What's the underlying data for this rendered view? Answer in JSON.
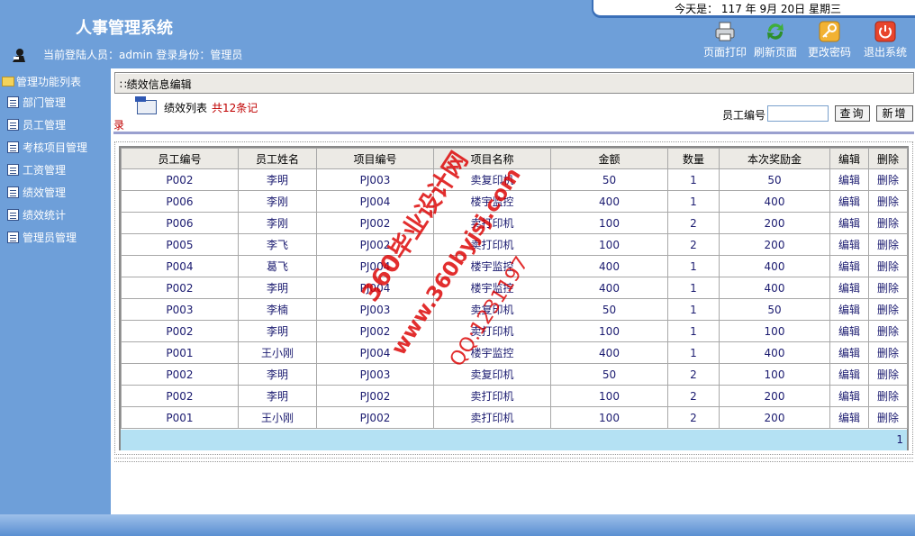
{
  "header": {
    "app_title": "人事管理系统",
    "date_text": "今天是： 117 年 9月 20日 星期三",
    "user_info": "当前登陆人员：admin 登录身份：管理员",
    "tools": [
      {
        "label": "页面打印",
        "icon": "printer-icon"
      },
      {
        "label": "刷新页面",
        "icon": "refresh-icon"
      },
      {
        "label": "更改密码",
        "icon": "key-icon"
      },
      {
        "label": "退出系统",
        "icon": "power-icon"
      }
    ]
  },
  "sidebar": {
    "title": "管理功能列表",
    "items": [
      {
        "label": "部门管理"
      },
      {
        "label": "员工管理"
      },
      {
        "label": "考核项目管理"
      },
      {
        "label": "工资管理"
      },
      {
        "label": "绩效管理"
      },
      {
        "label": "绩效统计"
      },
      {
        "label": "管理员管理"
      }
    ]
  },
  "main": {
    "section_title": "∷绩效信息编辑",
    "list_title": "绩效列表",
    "list_count_a": "共12条记",
    "list_count_b": "录",
    "search_label": "员工编号",
    "search_value": "",
    "query_label": "查询",
    "add_label": "新增",
    "columns": [
      "员工编号",
      "员工姓名",
      "项目编号",
      "项目名称",
      "金额",
      "数量",
      "本次奖励金",
      "编辑",
      "删除"
    ],
    "rows": [
      [
        "P002",
        "李明",
        "PJ003",
        "卖复印机",
        "50",
        "1",
        "50",
        "编辑",
        "删除"
      ],
      [
        "P006",
        "李刚",
        "PJ004",
        "楼宇监控",
        "400",
        "1",
        "400",
        "编辑",
        "删除"
      ],
      [
        "P006",
        "李刚",
        "PJ002",
        "卖打印机",
        "100",
        "2",
        "200",
        "编辑",
        "删除"
      ],
      [
        "P005",
        "李飞",
        "PJ002",
        "卖打印机",
        "100",
        "2",
        "200",
        "编辑",
        "删除"
      ],
      [
        "P004",
        "葛飞",
        "PJ004",
        "楼宇监控",
        "400",
        "1",
        "400",
        "编辑",
        "删除"
      ],
      [
        "P002",
        "李明",
        "PJ004",
        "楼宇监控",
        "400",
        "1",
        "400",
        "编辑",
        "删除"
      ],
      [
        "P003",
        "李楠",
        "PJ003",
        "卖复印机",
        "50",
        "1",
        "50",
        "编辑",
        "删除"
      ],
      [
        "P002",
        "李明",
        "PJ002",
        "卖打印机",
        "100",
        "1",
        "100",
        "编辑",
        "删除"
      ],
      [
        "P001",
        "王小刚",
        "PJ004",
        "楼宇监控",
        "400",
        "1",
        "400",
        "编辑",
        "删除"
      ],
      [
        "P002",
        "李明",
        "PJ003",
        "卖复印机",
        "50",
        "2",
        "100",
        "编辑",
        "删除"
      ],
      [
        "P002",
        "李明",
        "PJ002",
        "卖打印机",
        "100",
        "2",
        "200",
        "编辑",
        "删除"
      ],
      [
        "P001",
        "王小刚",
        "PJ002",
        "卖打印机",
        "100",
        "2",
        "200",
        "编辑",
        "删除"
      ]
    ],
    "pager": "1"
  },
  "watermark": {
    "line1": "360毕业设计网",
    "line2": "www.360byjsj.com",
    "line3": "QQ:1231197"
  }
}
